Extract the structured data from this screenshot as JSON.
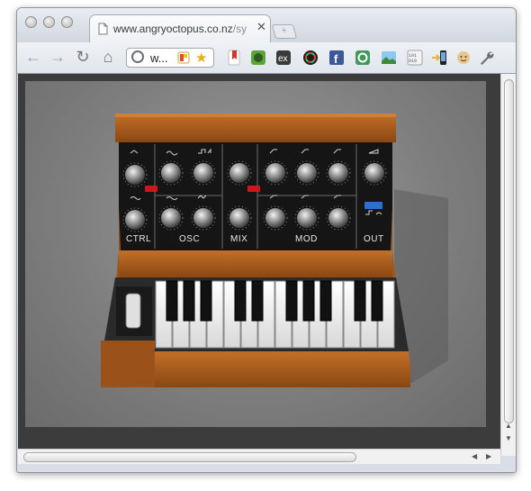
{
  "browser": {
    "tab": {
      "title_visible": "www.angryoctopus.co.nz",
      "title_truncated": "/sy",
      "close_glyph": "✕"
    },
    "new_tab_glyph": "+",
    "toolbar": {
      "back_glyph": "←",
      "forward_glyph": "→",
      "reload_glyph": "↻",
      "home_glyph": "⌂",
      "omnibox_text": "w...",
      "star_glyph": "★",
      "wrench_glyph": "🔧"
    },
    "extensions": [
      {
        "name": "bookmark-icon",
        "color": "#d9342b"
      },
      {
        "name": "evernote-icon",
        "color": "#5aa63a"
      },
      {
        "name": "ex-icon",
        "color": "#3a3a3a"
      },
      {
        "name": "color-wheel-icon",
        "color": "#1c1c1c"
      },
      {
        "name": "facebook-icon",
        "color": "#3b5998"
      },
      {
        "name": "refresh-green-icon",
        "color": "#3f9a5a"
      },
      {
        "name": "landscape-icon",
        "color": "#4a8fc7"
      },
      {
        "name": "binary-icon",
        "color": "#9da3aa"
      },
      {
        "name": "phone-sync-icon",
        "color": "#e3b83a"
      },
      {
        "name": "face-icon",
        "color": "#e7c88f"
      }
    ]
  },
  "synth": {
    "section_labels": [
      "CTRL",
      "OSC",
      "MIX",
      "MOD",
      "OUT"
    ],
    "colors": {
      "wood": "#a35a1c",
      "panel": "#141414",
      "red_switch": "#d0141c",
      "blue_switch": "#2a6fd6"
    }
  },
  "scroll_arrows": {
    "up": "▲",
    "down": "▼",
    "left": "◀",
    "right": "▶"
  }
}
